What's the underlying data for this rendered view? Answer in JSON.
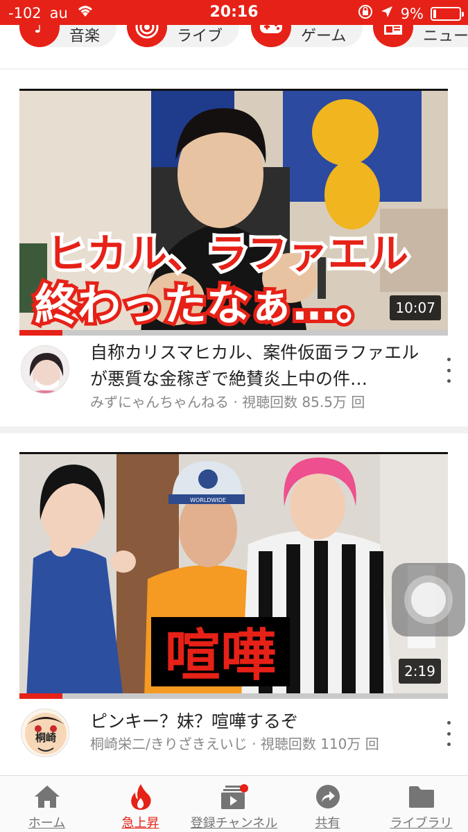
{
  "status_bar": {
    "signal": "-102",
    "carrier": "au",
    "time": "20:16",
    "battery": "9%"
  },
  "categories": [
    {
      "label": "音楽",
      "icon": "music-note-icon"
    },
    {
      "label": "ライブ",
      "icon": "live-broadcast-icon"
    },
    {
      "label": "ゲーム",
      "icon": "gamepad-icon"
    },
    {
      "label": "ニュー",
      "icon": "news-icon"
    }
  ],
  "videos": [
    {
      "thumbnail_caption_line1": "ヒカル、ラファエル",
      "thumbnail_caption_line2": "終わったなぁ…。",
      "duration": "10:07",
      "watched_fraction": 0.1,
      "title": "自称カリスマヒカル、案件仮面ラファエルが悪質な金稼ぎで絶賛炎上中の件…",
      "meta": "みずにゃんちゃんねる · 視聴回数 85.5万 回"
    },
    {
      "thumbnail_caption": "喧嘩",
      "cap_text": "WORLDWIDE",
      "duration": "2:19",
      "watched_fraction": 0.1,
      "title": "ピンキー？妹？喧嘩するぞ",
      "meta": "桐崎栄二/きりざきえいじ · 視聴回数 110万 回",
      "avatar_text": "桐崎"
    }
  ],
  "bottom_nav": [
    {
      "label": "ホーム",
      "icon": "home-icon",
      "active": false
    },
    {
      "label": "急上昇",
      "icon": "flame-icon",
      "active": true
    },
    {
      "label": "登録チャンネル",
      "icon": "subscriptions-icon",
      "active": false
    },
    {
      "label": "共有",
      "icon": "share-icon",
      "active": false
    },
    {
      "label": "ライブラリ",
      "icon": "folder-icon",
      "active": false
    }
  ],
  "colors": {
    "brand_red": "#e62117",
    "inactive_nav": "#757575",
    "meta_gray": "#888888"
  }
}
